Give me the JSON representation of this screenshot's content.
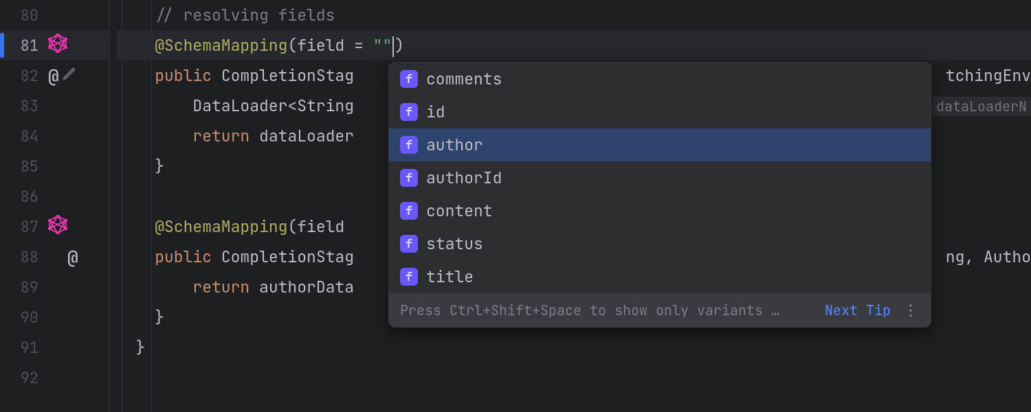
{
  "lines": {
    "80": {
      "num": "80",
      "comment": "// resolving fields"
    },
    "81": {
      "num": "81",
      "anno": "@SchemaMapping",
      "open": "(",
      "paramName": "field",
      "eq": " = ",
      "str": "\"\"",
      "close": ")"
    },
    "82": {
      "num": "82",
      "kw": "public",
      "type": " CompletionStag",
      "tail": "tchingEnv"
    },
    "83": {
      "num": "83",
      "text": "DataLoader<String",
      "tail": "dataLoaderN"
    },
    "84": {
      "num": "84",
      "kw": "return",
      "text": " dataLoader"
    },
    "85": {
      "num": "85",
      "brace": "}"
    },
    "86": {
      "num": "86"
    },
    "87": {
      "num": "87",
      "anno": "@SchemaMapping",
      "open": "(",
      "paramName": "field"
    },
    "88": {
      "num": "88",
      "kw": "public",
      "type": " CompletionStag",
      "tail": "ng, Autho"
    },
    "89": {
      "num": "89",
      "kw": "return",
      "text": " authorData"
    },
    "90": {
      "num": "90",
      "brace": "}"
    },
    "91": {
      "num": "91",
      "brace": "}"
    },
    "92": {
      "num": "92"
    }
  },
  "completion": {
    "items": [
      {
        "label": "comments",
        "kind_badge": "f",
        "selected": false
      },
      {
        "label": "id",
        "kind_badge": "f",
        "selected": false
      },
      {
        "label": "author",
        "kind_badge": "f",
        "selected": true
      },
      {
        "label": "authorId",
        "kind_badge": "f",
        "selected": false
      },
      {
        "label": "content",
        "kind_badge": "f",
        "selected": false
      },
      {
        "label": "status",
        "kind_badge": "f",
        "selected": false
      },
      {
        "label": "title",
        "kind_badge": "f",
        "selected": false
      }
    ],
    "footer_hint": "Press Ctrl+Shift+Space to show only variants …",
    "footer_link": "Next Tip"
  },
  "icons": {
    "graphql": "graphql-icon",
    "at": "@",
    "pencil": "pencil-icon"
  }
}
